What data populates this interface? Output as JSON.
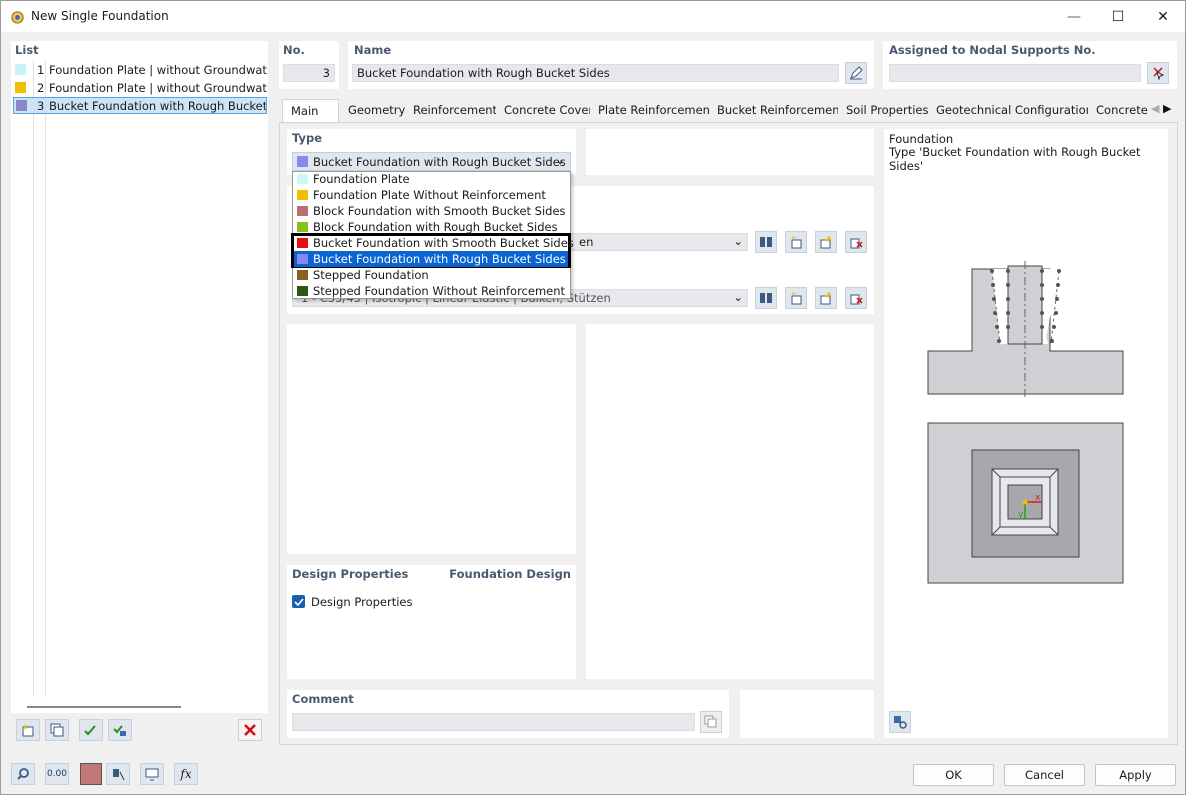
{
  "window": {
    "title": "New Single Foundation",
    "minimize": "—",
    "maximize": "☐",
    "close": "✕"
  },
  "list": {
    "label": "List",
    "items": [
      {
        "num": "1",
        "text": "Foundation Plate | without Groundwater (",
        "color": "#c8f4f8"
      },
      {
        "num": "2",
        "text": "Foundation Plate | without Groundwater (",
        "color": "#f0c000"
      },
      {
        "num": "3",
        "text": "Bucket Foundation with Rough Bucket Sid",
        "color": "#8888c8"
      }
    ]
  },
  "no": {
    "label": "No.",
    "value": "3"
  },
  "name": {
    "label": "Name",
    "value": "Bucket Foundation with Rough Bucket Sides"
  },
  "assigned": {
    "label": "Assigned to Nodal Supports No.",
    "value": ""
  },
  "tabs": [
    "Main",
    "Geometry",
    "Reinforcement",
    "Concrete Cover",
    "Plate Reinforcement",
    "Bucket Reinforcement",
    "Soil Properties",
    "Geotechnical Configuration",
    "Concrete"
  ],
  "type": {
    "label": "Type",
    "selected": "Bucket Foundation with Rough Bucket Sides",
    "selected_color": "#8888ee",
    "options": [
      {
        "text": "Foundation Plate",
        "color": "#c8f8f8"
      },
      {
        "text": "Foundation Plate Without Reinforcement",
        "color": "#f0c000"
      },
      {
        "text": "Block Foundation with Smooth Bucket Sides",
        "color": "#b87070"
      },
      {
        "text": "Block Foundation with Rough Bucket Sides",
        "color": "#88c020"
      },
      {
        "text": "Bucket Foundation with Smooth Bucket Sides",
        "color": "#e81010"
      },
      {
        "text": "Bucket Foundation with Rough Bucket Sides",
        "color": "#8888ee"
      },
      {
        "text": "Stepped Foundation",
        "color": "#8a6020"
      },
      {
        "text": "Stepped Foundation Without Reinforcement",
        "color": "#2a5a10"
      }
    ]
  },
  "material_rows": [
    {
      "value": "en"
    },
    {
      "value": "1 - C35/45 | Isotropic | Linear Elastic | Balken, Stützen"
    }
  ],
  "design": {
    "label": "Design Properties",
    "addon": "Foundation Design",
    "checkbox_label": "Design Properties",
    "checked": true
  },
  "comment": {
    "label": "Comment",
    "value": ""
  },
  "preview": {
    "title": "Foundation",
    "subtitle": "Type 'Bucket Foundation with Rough Bucket Sides'"
  },
  "bottom_tools": {
    "value_display": "0.00"
  },
  "buttons": {
    "ok": "OK",
    "cancel": "Cancel",
    "apply": "Apply"
  }
}
